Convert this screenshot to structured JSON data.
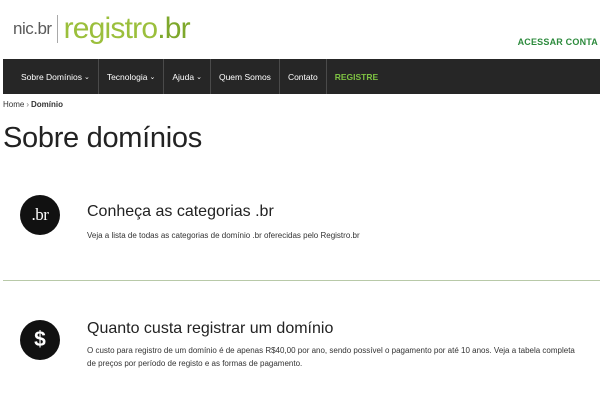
{
  "logo": {
    "nic": "nic.br",
    "registro": "registro",
    "br": ".br"
  },
  "header": {
    "account": "ACESSAR CONTA"
  },
  "nav": {
    "items": [
      {
        "label": "Sobre Domínios",
        "chevron": "⌄"
      },
      {
        "label": "Tecnologia",
        "chevron": "⌄"
      },
      {
        "label": "Ajuda",
        "chevron": "⌄"
      },
      {
        "label": "Quem Somos"
      },
      {
        "label": "Contato"
      },
      {
        "label": "REGISTRE"
      }
    ],
    "colors": {
      "background": "#262626",
      "register": "#7ec242"
    }
  },
  "breadcrumb": {
    "home": "Home",
    "separator": "›",
    "current": "Domínio"
  },
  "page": {
    "title": "Sobre domínios"
  },
  "cards": [
    {
      "icon": "br-icon",
      "icon_text": ".br",
      "title": "Conheça as categorias .br",
      "description": "Veja a lista de todas as categorias de domínio .br oferecidas pelo Registro.br"
    },
    {
      "icon": "dollar-icon",
      "icon_text": "$",
      "title": "Quanto custa registrar um domínio",
      "description": "O custo para registro de um domínio é de apenas R$40,00 por ano, sendo possível o pagamento por até 10 anos. Veja a tabela completa de preços por período de registo e as formas de pagamento."
    }
  ]
}
